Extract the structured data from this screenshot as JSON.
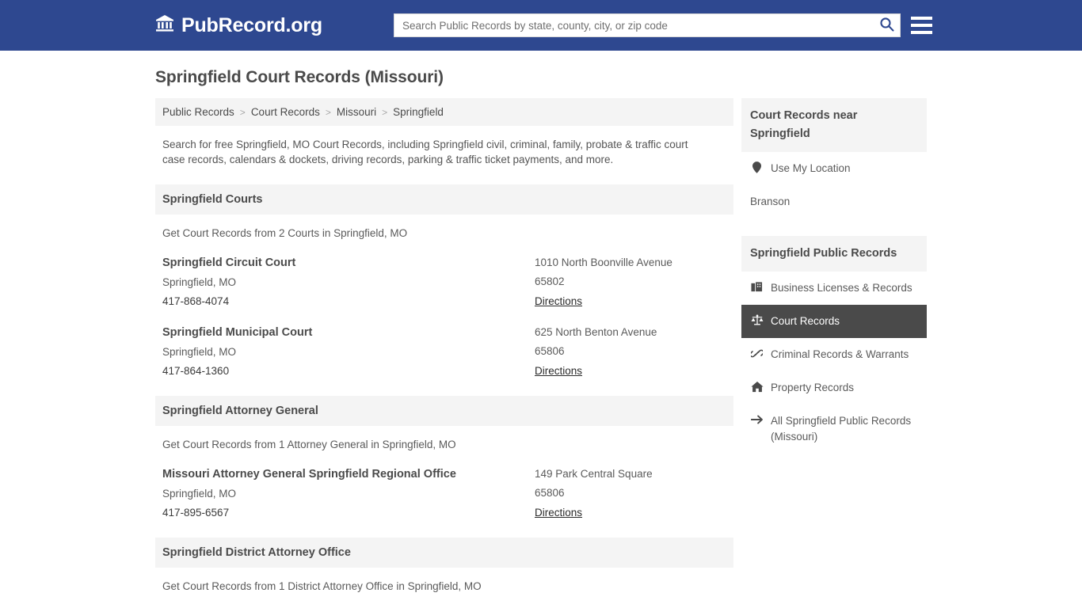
{
  "header": {
    "brand": "PubRecord.org",
    "brand_icon": "bank-icon",
    "search_placeholder": "Search Public Records by state, county, city, or zip code",
    "search_value": "",
    "search_icon": "search-icon",
    "menu_icon": "hamburger-menu-icon",
    "bg_color": "#2e4890"
  },
  "page": {
    "title": "Springfield Court Records (Missouri)",
    "intro": "Search for free Springfield, MO Court Records, including Springfield civil, criminal, family, probate & traffic court case records, calendars & dockets, driving records, parking & traffic ticket payments, and more."
  },
  "breadcrumb": {
    "separator": ">",
    "items": [
      {
        "label": "Public Records"
      },
      {
        "label": "Court Records"
      },
      {
        "label": "Missouri"
      },
      {
        "label": "Springfield"
      }
    ]
  },
  "sections": [
    {
      "heading": "Springfield Courts",
      "subtitle": "Get Court Records from 2 Courts in Springfield, MO",
      "listings": [
        {
          "name": "Springfield Circuit Court",
          "city_state": "Springfield, MO",
          "phone": "417-868-4074",
          "address": "1010 North Boonville Avenue",
          "zip": "65802",
          "directions": "Directions"
        },
        {
          "name": "Springfield Municipal Court",
          "city_state": "Springfield, MO",
          "phone": "417-864-1360",
          "address": "625 North Benton Avenue",
          "zip": "65806",
          "directions": "Directions"
        }
      ]
    },
    {
      "heading": "Springfield Attorney General",
      "subtitle": "Get Court Records from 1 Attorney General in Springfield, MO",
      "listings": [
        {
          "name": "Missouri Attorney General Springfield Regional Office",
          "city_state": "Springfield, MO",
          "phone": "417-895-6567",
          "address": "149 Park Central Square",
          "zip": "65806",
          "directions": "Directions"
        }
      ]
    },
    {
      "heading": "Springfield District Attorney Office",
      "subtitle": "Get Court Records from 1 District Attorney Office in Springfield, MO",
      "listings": []
    }
  ],
  "sidebar": {
    "nearby": {
      "heading": "Court Records near Springfield",
      "items": [
        {
          "label": "Use My Location",
          "icon": "map-pin-icon",
          "has_icon": true
        },
        {
          "label": "Branson",
          "icon": "",
          "has_icon": false
        }
      ]
    },
    "public_records": {
      "heading": "Springfield Public Records",
      "active_color": "#4a4a4a",
      "items": [
        {
          "label": "Business Licenses & Records",
          "icon": "briefcase-icon",
          "active": false
        },
        {
          "label": "Court Records",
          "icon": "scales-of-justice-icon",
          "active": true
        },
        {
          "label": "Criminal Records & Warrants",
          "icon": "handcuffs-icon",
          "active": false
        },
        {
          "label": "Property Records",
          "icon": "house-icon",
          "active": false
        },
        {
          "label": "All Springfield Public Records (Missouri)",
          "icon": "arrow-right-icon",
          "active": false
        }
      ]
    }
  }
}
